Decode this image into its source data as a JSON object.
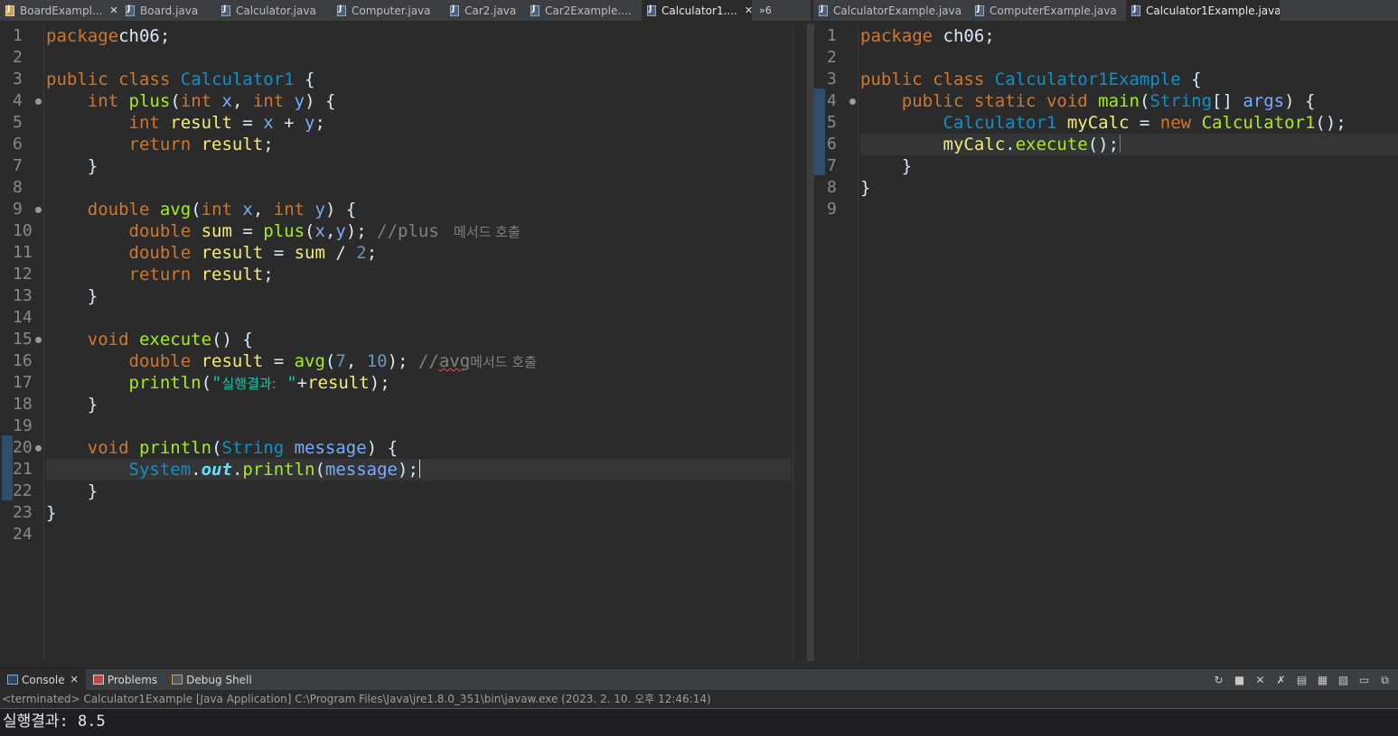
{
  "left_tabs": [
    {
      "label": "BoardExampl...",
      "closable": true,
      "active": false,
      "style": "board"
    },
    {
      "label": "Board.java",
      "closable": false,
      "active": false
    },
    {
      "label": "Calculator.java",
      "closable": false,
      "active": false
    },
    {
      "label": "Computer.java",
      "closable": false,
      "active": false
    },
    {
      "label": "Car2.java",
      "closable": false,
      "active": false
    },
    {
      "label": "Car2Example....",
      "closable": false,
      "active": false
    },
    {
      "label": "Calculator1....",
      "closable": true,
      "active": true
    }
  ],
  "left_overflow": "»6",
  "right_tabs": [
    {
      "label": "CalculatorExample.java",
      "closable": false,
      "active": false
    },
    {
      "label": "ComputerExample.java",
      "closable": false,
      "active": false
    },
    {
      "label": "Calculator1Example.java",
      "closable": true,
      "active": true
    }
  ],
  "close_glyph": "✕",
  "left_editor_lines": [
    {
      "n": "1",
      "t": [
        [
          "kw",
          "package"
        ],
        [
          "",
          "ch06;"
        ]
      ]
    },
    {
      "n": "2",
      "t": []
    },
    {
      "n": "3",
      "t": [
        [
          "kw",
          "public"
        ],
        [
          "",
          " "
        ],
        [
          "kw",
          "class"
        ],
        [
          "",
          " "
        ],
        [
          "cls",
          "Calculator1"
        ],
        [
          "",
          " {"
        ]
      ]
    },
    {
      "n": "4",
      "fold": true,
      "t": [
        [
          "",
          "    "
        ],
        [
          "kw",
          "int"
        ],
        [
          "",
          " "
        ],
        [
          "mth",
          "plus"
        ],
        [
          "",
          "("
        ],
        [
          "kw",
          "int"
        ],
        [
          "",
          " "
        ],
        [
          "var",
          "x"
        ],
        [
          ", "
        ],
        [
          "kw",
          "int"
        ],
        [
          "",
          " "
        ],
        [
          "var",
          "y"
        ],
        [
          ") {"
        ]
      ]
    },
    {
      "n": "5",
      "t": [
        [
          "",
          "        "
        ],
        [
          "kw",
          "int"
        ],
        [
          "",
          " "
        ],
        [
          "loc",
          "result"
        ],
        [
          "",
          " = "
        ],
        [
          "var",
          "x"
        ],
        [
          "",
          " + "
        ],
        [
          "var",
          "y"
        ],
        [
          ";"
        ]
      ]
    },
    {
      "n": "6",
      "t": [
        [
          "",
          "        "
        ],
        [
          "kw",
          "return"
        ],
        [
          "",
          " "
        ],
        [
          "loc",
          "result"
        ],
        [
          ";"
        ]
      ]
    },
    {
      "n": "7",
      "t": [
        [
          "",
          "    }"
        ]
      ]
    },
    {
      "n": "8",
      "t": []
    },
    {
      "n": "9",
      "fold": true,
      "t": [
        [
          "",
          "    "
        ],
        [
          "kw",
          "double"
        ],
        [
          "",
          " "
        ],
        [
          "mth",
          "avg"
        ],
        [
          "",
          "("
        ],
        [
          "kw",
          "int"
        ],
        [
          "",
          " "
        ],
        [
          "var",
          "x"
        ],
        [
          ", "
        ],
        [
          "kw",
          "int"
        ],
        [
          "",
          " "
        ],
        [
          "var",
          "y"
        ],
        [
          ") {"
        ]
      ]
    },
    {
      "n": "10",
      "t": [
        [
          "",
          "        "
        ],
        [
          "kw",
          "double"
        ],
        [
          "",
          " "
        ],
        [
          "loc",
          "sum"
        ],
        [
          "",
          " = "
        ],
        [
          "mth",
          "plus"
        ],
        [
          "",
          "("
        ],
        [
          "var",
          "x"
        ],
        [
          ","
        ],
        [
          "var",
          "y"
        ],
        [
          "); "
        ],
        [
          "cmt",
          "//plus "
        ],
        [
          "cmt kr",
          " 메서드 호출"
        ]
      ]
    },
    {
      "n": "11",
      "t": [
        [
          "",
          "        "
        ],
        [
          "kw",
          "double"
        ],
        [
          "",
          " "
        ],
        [
          "loc",
          "result"
        ],
        [
          "",
          " = "
        ],
        [
          "loc",
          "sum"
        ],
        [
          "",
          " / "
        ],
        [
          "num",
          "2"
        ],
        [
          ";"
        ]
      ]
    },
    {
      "n": "12",
      "t": [
        [
          "",
          "        "
        ],
        [
          "kw",
          "return"
        ],
        [
          "",
          " "
        ],
        [
          "loc",
          "result"
        ],
        [
          ";"
        ]
      ]
    },
    {
      "n": "13",
      "t": [
        [
          "",
          "    }"
        ]
      ]
    },
    {
      "n": "14",
      "t": []
    },
    {
      "n": "15",
      "fold": true,
      "t": [
        [
          "",
          "    "
        ],
        [
          "kw",
          "void"
        ],
        [
          "",
          " "
        ],
        [
          "mth",
          "execute"
        ],
        [
          "",
          "() {"
        ]
      ]
    },
    {
      "n": "16",
      "t": [
        [
          "",
          "        "
        ],
        [
          "kw",
          "double"
        ],
        [
          "",
          " "
        ],
        [
          "loc",
          "result"
        ],
        [
          "",
          " = "
        ],
        [
          "mth",
          "avg"
        ],
        [
          "",
          "("
        ],
        [
          "num",
          "7"
        ],
        [
          ", "
        ],
        [
          "num",
          "10"
        ],
        [
          "); "
        ],
        [
          "cmt",
          "//"
        ],
        [
          "cmt squig",
          "avg"
        ],
        [
          "cmt kr",
          "메서드 호출"
        ]
      ]
    },
    {
      "n": "17",
      "t": [
        [
          "",
          "        "
        ],
        [
          "mth",
          "println"
        ],
        [
          "",
          "("
        ],
        [
          "str",
          "\""
        ],
        [
          "str kr",
          "실행결과:"
        ],
        [
          "str",
          " \""
        ],
        [
          "",
          "+"
        ],
        [
          "loc",
          "result"
        ],
        [
          ");"
        ]
      ]
    },
    {
      "n": "18",
      "t": [
        [
          "",
          "    }"
        ]
      ]
    },
    {
      "n": "19",
      "t": []
    },
    {
      "n": "20",
      "fold": true,
      "t": [
        [
          "",
          "    "
        ],
        [
          "kw",
          "void"
        ],
        [
          "",
          " "
        ],
        [
          "mth",
          "println"
        ],
        [
          "",
          "("
        ],
        [
          "cls",
          "String"
        ],
        [
          "",
          " "
        ],
        [
          "var",
          "message"
        ],
        [
          ") {"
        ]
      ]
    },
    {
      "n": "21",
      "hl": true,
      "caret": "white",
      "t": [
        [
          "",
          "        "
        ],
        [
          "cls",
          "System"
        ],
        [
          "",
          "."
        ],
        [
          "fld",
          "out"
        ],
        [
          "",
          "."
        ],
        [
          "mth",
          "println"
        ],
        [
          "",
          "("
        ],
        [
          "var",
          "message"
        ],
        [
          ");"
        ]
      ]
    },
    {
      "n": "22",
      "t": [
        [
          "",
          "    }"
        ]
      ]
    },
    {
      "n": "23",
      "t": [
        [
          "",
          "}"
        ]
      ]
    },
    {
      "n": "24",
      "t": []
    }
  ],
  "right_editor_lines": [
    {
      "n": "1",
      "t": [
        [
          "kw",
          "package"
        ],
        [
          "",
          " ch06;"
        ]
      ]
    },
    {
      "n": "2",
      "t": []
    },
    {
      "n": "3",
      "t": [
        [
          "kw",
          "public"
        ],
        [
          "",
          " "
        ],
        [
          "kw",
          "class"
        ],
        [
          "",
          " "
        ],
        [
          "cls",
          "Calculator1Example"
        ],
        [
          "",
          " {"
        ]
      ]
    },
    {
      "n": "4",
      "fold": true,
      "t": [
        [
          "",
          "    "
        ],
        [
          "kw",
          "public"
        ],
        [
          "",
          " "
        ],
        [
          "kw",
          "static"
        ],
        [
          "",
          " "
        ],
        [
          "kw",
          "void"
        ],
        [
          "",
          " "
        ],
        [
          "mth",
          "main"
        ],
        [
          "",
          "("
        ],
        [
          "cls",
          "String"
        ],
        [
          "",
          "[] "
        ],
        [
          "var",
          "args"
        ],
        [
          ") {"
        ]
      ]
    },
    {
      "n": "5",
      "t": [
        [
          "",
          "        "
        ],
        [
          "cls",
          "Calculator1"
        ],
        [
          "",
          " "
        ],
        [
          "loc",
          "myCalc"
        ],
        [
          "",
          " = "
        ],
        [
          "kw",
          "new"
        ],
        [
          "",
          " "
        ],
        [
          "mth",
          "Calculator1"
        ],
        [
          "",
          "();"
        ]
      ]
    },
    {
      "n": "6",
      "hl": true,
      "caret": "green",
      "t": [
        [
          "",
          "        "
        ],
        [
          "loc",
          "myCalc"
        ],
        [
          "",
          "."
        ],
        [
          "mth",
          "execute"
        ],
        [
          "",
          "();"
        ]
      ]
    },
    {
      "n": "7",
      "t": [
        [
          "",
          "    }"
        ]
      ]
    },
    {
      "n": "8",
      "t": [
        [
          "",
          "}"
        ]
      ]
    },
    {
      "n": "9",
      "t": []
    }
  ],
  "console": {
    "tabs": [
      {
        "label": "Console",
        "icon": "console-icon",
        "active": true,
        "closable": true
      },
      {
        "label": "Problems",
        "icon": "problems-icon",
        "active": false,
        "closable": false
      },
      {
        "label": "Debug Shell",
        "icon": "debug-shell-icon",
        "active": false,
        "closable": false
      }
    ],
    "tools": [
      "↻",
      "■",
      "✕",
      "✗",
      "▤",
      "▦",
      "▧",
      "▭",
      "⧉"
    ],
    "status": "<terminated> Calculator1Example [Java Application] C:\\Program Files\\Java\\jre1.8.0_351\\bin\\javaw.exe (2023. 2. 10. 오후 12:46:14)",
    "output": "실행결과: 8.5"
  }
}
